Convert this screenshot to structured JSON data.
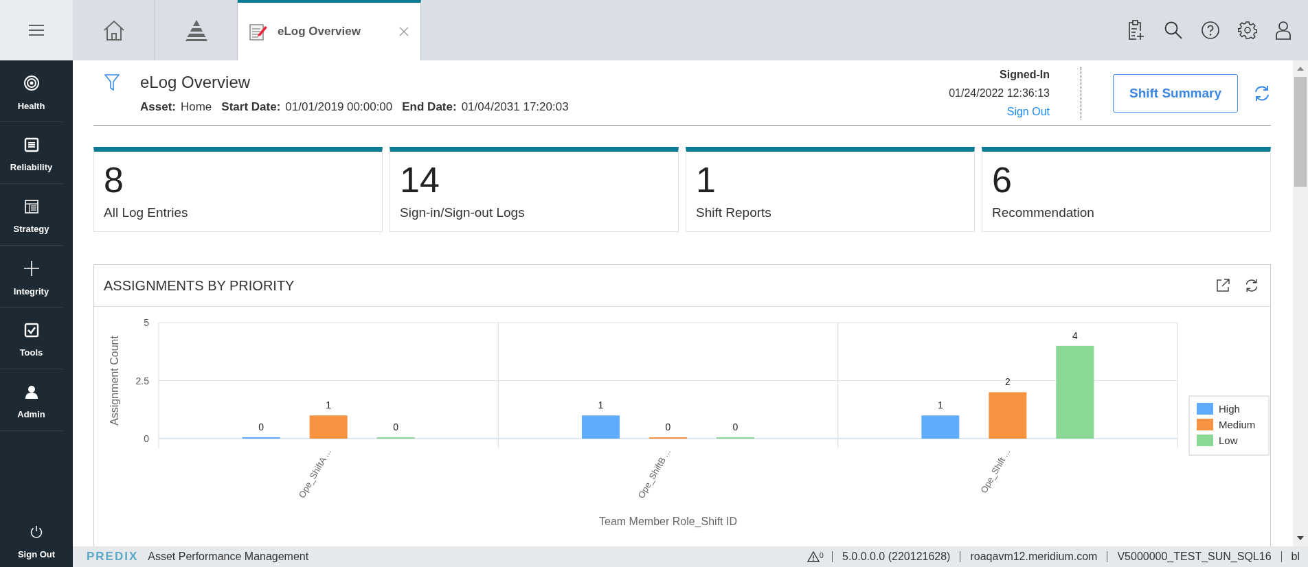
{
  "sidebar": {
    "items": [
      {
        "label": "Health"
      },
      {
        "label": "Reliability"
      },
      {
        "label": "Strategy"
      },
      {
        "label": "Integrity"
      },
      {
        "label": "Tools"
      },
      {
        "label": "Admin"
      }
    ],
    "sign_out": "Sign Out"
  },
  "tabs": [
    {
      "kind": "icon",
      "selected": false
    },
    {
      "kind": "icon",
      "selected": false
    },
    {
      "kind": "text",
      "label": "eLog Overview",
      "selected": true
    }
  ],
  "header": {
    "title": "eLog Overview",
    "fields": [
      {
        "label": "Asset:",
        "value": "Home"
      },
      {
        "label": "Start Date:",
        "value": "01/01/2019 00:00:00"
      },
      {
        "label": "End Date:",
        "value": "01/04/2031 17:20:03"
      }
    ],
    "signin": {
      "heading": "Signed-In",
      "time": "01/24/2022 12:36:13",
      "link": "Sign Out"
    },
    "button": "Shift Summary"
  },
  "cards": [
    {
      "value": "8",
      "label": "All Log Entries"
    },
    {
      "value": "14",
      "label": "Sign-in/Sign-out Logs"
    },
    {
      "value": "1",
      "label": "Shift Reports"
    },
    {
      "value": "6",
      "label": "Recommendation"
    }
  ],
  "panel": {
    "title": "ASSIGNMENTS BY PRIORITY",
    "chart_data": {
      "type": "bar",
      "xlabel": "Team Member Role_Shift ID",
      "ylabel": "Assignment Count",
      "categories": [
        "Ope_ShiftA ...",
        "Ope_ShiftB ...",
        "Ope_Shift ..."
      ],
      "series": [
        {
          "name": "High",
          "color": "#60acfc",
          "values": [
            0,
            1,
            1
          ]
        },
        {
          "name": "Medium",
          "color": "#f79240",
          "values": [
            1,
            0,
            2
          ]
        },
        {
          "name": "Low",
          "color": "#8bd895",
          "values": [
            0,
            0,
            4
          ]
        }
      ],
      "legend": true,
      "ylim": [
        0,
        5
      ],
      "yticks": [
        0,
        {
          "value": 2.5,
          "label": "2.5"
        },
        5
      ],
      "data_labels": true,
      "value_labels": [
        [
          "0",
          "1",
          "1"
        ],
        [
          "1",
          "0",
          "2"
        ],
        [
          "0",
          "0",
          "4"
        ]
      ]
    }
  },
  "status_bar": {
    "brand": "PREDIX",
    "product": "Asset Performance Management",
    "alerts": "0",
    "items": [
      "5.0.0.0.0 (220121628)",
      "roaqavm12.meridium.com",
      "V5000000_TEST_SUN_SQL16",
      "bl"
    ]
  }
}
